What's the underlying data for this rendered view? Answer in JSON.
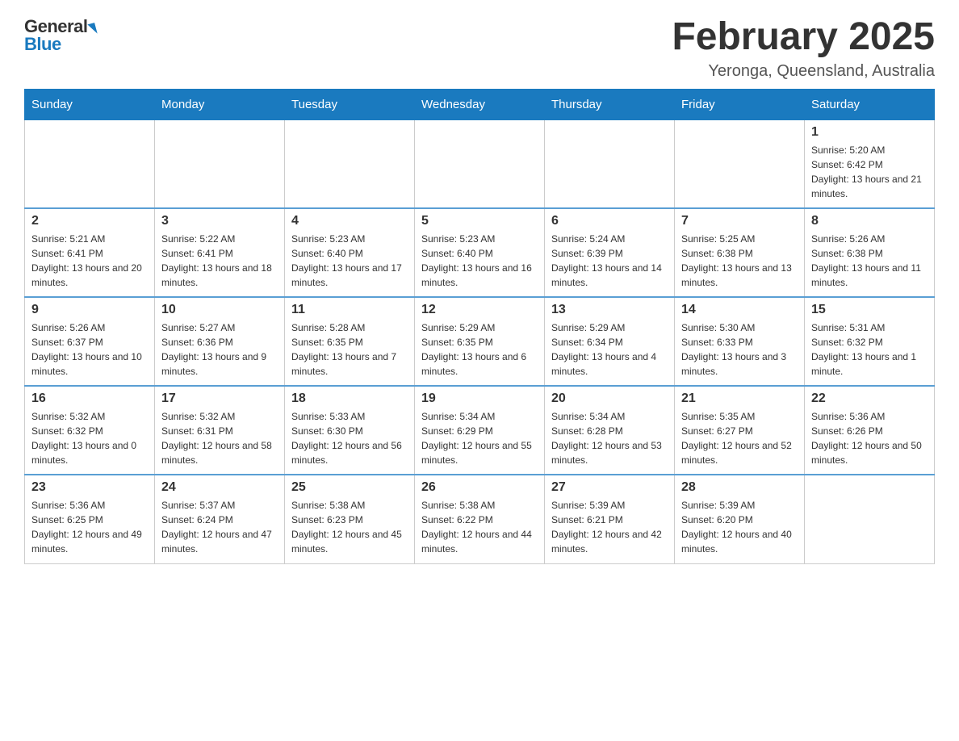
{
  "header": {
    "logo_general": "General",
    "logo_blue": "Blue",
    "title": "February 2025",
    "location": "Yeronga, Queensland, Australia"
  },
  "weekdays": [
    "Sunday",
    "Monday",
    "Tuesday",
    "Wednesday",
    "Thursday",
    "Friday",
    "Saturday"
  ],
  "weeks": [
    [
      {
        "day": "",
        "info": ""
      },
      {
        "day": "",
        "info": ""
      },
      {
        "day": "",
        "info": ""
      },
      {
        "day": "",
        "info": ""
      },
      {
        "day": "",
        "info": ""
      },
      {
        "day": "",
        "info": ""
      },
      {
        "day": "1",
        "info": "Sunrise: 5:20 AM\nSunset: 6:42 PM\nDaylight: 13 hours and 21 minutes."
      }
    ],
    [
      {
        "day": "2",
        "info": "Sunrise: 5:21 AM\nSunset: 6:41 PM\nDaylight: 13 hours and 20 minutes."
      },
      {
        "day": "3",
        "info": "Sunrise: 5:22 AM\nSunset: 6:41 PM\nDaylight: 13 hours and 18 minutes."
      },
      {
        "day": "4",
        "info": "Sunrise: 5:23 AM\nSunset: 6:40 PM\nDaylight: 13 hours and 17 minutes."
      },
      {
        "day": "5",
        "info": "Sunrise: 5:23 AM\nSunset: 6:40 PM\nDaylight: 13 hours and 16 minutes."
      },
      {
        "day": "6",
        "info": "Sunrise: 5:24 AM\nSunset: 6:39 PM\nDaylight: 13 hours and 14 minutes."
      },
      {
        "day": "7",
        "info": "Sunrise: 5:25 AM\nSunset: 6:38 PM\nDaylight: 13 hours and 13 minutes."
      },
      {
        "day": "8",
        "info": "Sunrise: 5:26 AM\nSunset: 6:38 PM\nDaylight: 13 hours and 11 minutes."
      }
    ],
    [
      {
        "day": "9",
        "info": "Sunrise: 5:26 AM\nSunset: 6:37 PM\nDaylight: 13 hours and 10 minutes."
      },
      {
        "day": "10",
        "info": "Sunrise: 5:27 AM\nSunset: 6:36 PM\nDaylight: 13 hours and 9 minutes."
      },
      {
        "day": "11",
        "info": "Sunrise: 5:28 AM\nSunset: 6:35 PM\nDaylight: 13 hours and 7 minutes."
      },
      {
        "day": "12",
        "info": "Sunrise: 5:29 AM\nSunset: 6:35 PM\nDaylight: 13 hours and 6 minutes."
      },
      {
        "day": "13",
        "info": "Sunrise: 5:29 AM\nSunset: 6:34 PM\nDaylight: 13 hours and 4 minutes."
      },
      {
        "day": "14",
        "info": "Sunrise: 5:30 AM\nSunset: 6:33 PM\nDaylight: 13 hours and 3 minutes."
      },
      {
        "day": "15",
        "info": "Sunrise: 5:31 AM\nSunset: 6:32 PM\nDaylight: 13 hours and 1 minute."
      }
    ],
    [
      {
        "day": "16",
        "info": "Sunrise: 5:32 AM\nSunset: 6:32 PM\nDaylight: 13 hours and 0 minutes."
      },
      {
        "day": "17",
        "info": "Sunrise: 5:32 AM\nSunset: 6:31 PM\nDaylight: 12 hours and 58 minutes."
      },
      {
        "day": "18",
        "info": "Sunrise: 5:33 AM\nSunset: 6:30 PM\nDaylight: 12 hours and 56 minutes."
      },
      {
        "day": "19",
        "info": "Sunrise: 5:34 AM\nSunset: 6:29 PM\nDaylight: 12 hours and 55 minutes."
      },
      {
        "day": "20",
        "info": "Sunrise: 5:34 AM\nSunset: 6:28 PM\nDaylight: 12 hours and 53 minutes."
      },
      {
        "day": "21",
        "info": "Sunrise: 5:35 AM\nSunset: 6:27 PM\nDaylight: 12 hours and 52 minutes."
      },
      {
        "day": "22",
        "info": "Sunrise: 5:36 AM\nSunset: 6:26 PM\nDaylight: 12 hours and 50 minutes."
      }
    ],
    [
      {
        "day": "23",
        "info": "Sunrise: 5:36 AM\nSunset: 6:25 PM\nDaylight: 12 hours and 49 minutes."
      },
      {
        "day": "24",
        "info": "Sunrise: 5:37 AM\nSunset: 6:24 PM\nDaylight: 12 hours and 47 minutes."
      },
      {
        "day": "25",
        "info": "Sunrise: 5:38 AM\nSunset: 6:23 PM\nDaylight: 12 hours and 45 minutes."
      },
      {
        "day": "26",
        "info": "Sunrise: 5:38 AM\nSunset: 6:22 PM\nDaylight: 12 hours and 44 minutes."
      },
      {
        "day": "27",
        "info": "Sunrise: 5:39 AM\nSunset: 6:21 PM\nDaylight: 12 hours and 42 minutes."
      },
      {
        "day": "28",
        "info": "Sunrise: 5:39 AM\nSunset: 6:20 PM\nDaylight: 12 hours and 40 minutes."
      },
      {
        "day": "",
        "info": ""
      }
    ]
  ]
}
